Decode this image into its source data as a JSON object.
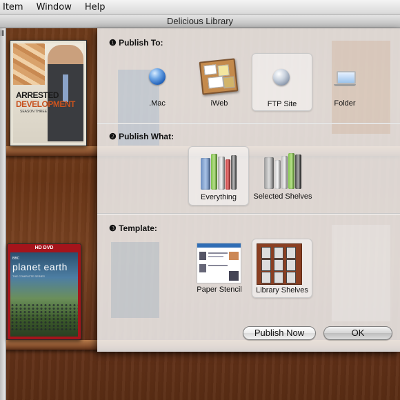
{
  "menubar": {
    "items": [
      "Item",
      "Window",
      "Help"
    ]
  },
  "window": {
    "title": "Delicious Library"
  },
  "shelf": {
    "items": [
      {
        "title_line1": "ARRESTED",
        "title_line2": "DEVELOPMENT",
        "subtitle": "SEASON THREE"
      },
      {
        "banner": "HD DVD",
        "network": "BBC",
        "title": "planet earth",
        "subtitle": "THE COMPLETE SERIES"
      }
    ]
  },
  "sheet": {
    "publish_to": {
      "title": "❶ Publish To:",
      "options": [
        {
          "label": ".Mac",
          "icon": "mac-globe-icon",
          "selected": false
        },
        {
          "label": "iWeb",
          "icon": "iweb-icon",
          "selected": false
        },
        {
          "label": "FTP Site",
          "icon": "ftp-globe-icon",
          "selected": true
        },
        {
          "label": "Folder",
          "icon": "laptop-icon",
          "selected": false
        }
      ]
    },
    "publish_what": {
      "title": "❷ Publish What:",
      "options": [
        {
          "label": "Everything",
          "icon": "books-icon",
          "selected": true
        },
        {
          "label": "Selected Shelves",
          "icon": "books-selected-icon",
          "selected": false
        }
      ]
    },
    "template": {
      "title": "❸ Template:",
      "options": [
        {
          "label": "Paper Stencil",
          "icon": "paper-stencil-thumbnail",
          "selected": false
        },
        {
          "label": "Library Shelves",
          "icon": "library-shelves-thumbnail",
          "selected": true
        }
      ]
    },
    "buttons": {
      "publish_now": "Publish Now",
      "ok": "OK"
    }
  },
  "colors": {
    "wood": "#6d3a1a",
    "accent_blue": "#1f5fb8",
    "panel": "#f0f0f0"
  }
}
